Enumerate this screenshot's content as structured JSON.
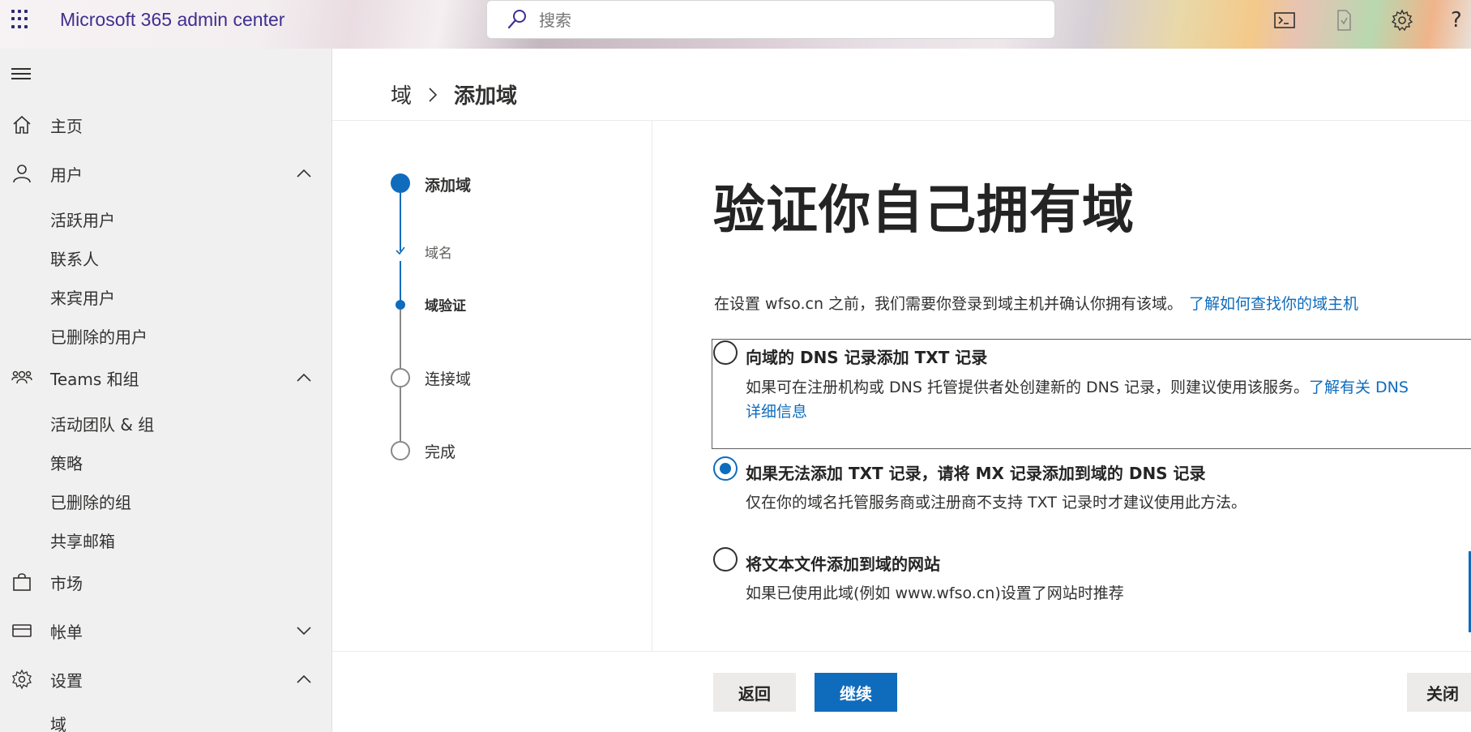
{
  "header": {
    "app_title": "Microsoft 365 admin center",
    "search_placeholder": "搜索",
    "icons": [
      "waffle-icon",
      "search-icon",
      "terminal-icon",
      "document-icon",
      "gear-icon",
      "help-icon"
    ],
    "help_label": "?"
  },
  "sidebar": {
    "items": [
      {
        "label": "主页",
        "icon": "home-icon"
      },
      {
        "label": "用户",
        "icon": "person-icon",
        "expanded": true,
        "children": [
          "活跃用户",
          "联系人",
          "来宾用户",
          "已删除的用户"
        ]
      },
      {
        "label": "Teams 和组",
        "icon": "people-icon",
        "expanded": true,
        "children": [
          "活动团队 & 组",
          "策略",
          "已删除的组",
          "共享邮箱"
        ]
      },
      {
        "label": "市场",
        "icon": "shopping-bag-icon"
      },
      {
        "label": "帐单",
        "icon": "card-icon",
        "expanded": false
      },
      {
        "label": "设置",
        "icon": "gear-icon",
        "expanded": true,
        "children": [
          "域"
        ]
      }
    ]
  },
  "breadcrumb": {
    "root": "域",
    "current": "添加域"
  },
  "steps": [
    {
      "label": "添加域",
      "state": "current"
    },
    {
      "label": "域名",
      "state": "done"
    },
    {
      "label": "域验证",
      "state": "current-sub"
    },
    {
      "label": "连接域",
      "state": "pending"
    },
    {
      "label": "完成",
      "state": "pending"
    }
  ],
  "content": {
    "title": "验证你自己拥有域",
    "intro": "在设置 wfso.cn 之前，我们需要你登录到域主机并确认你拥有该域。",
    "intro_link": "了解如何查找你的域主机",
    "options": [
      {
        "title": "向域的 DNS 记录添加 TXT 记录",
        "desc": "如果可在注册机构或 DNS 托管提供者处创建新的 DNS 记录，则建议使用该服务。",
        "link": "了解有关 DNS",
        "link2": "详细信息",
        "checked": false
      },
      {
        "title": "如果无法添加 TXT 记录，请将 MX 记录添加到域的 DNS 记录",
        "desc": "仅在你的域名托管服务商或注册商不支持 TXT 记录时才建议使用此方法。",
        "checked": true
      },
      {
        "title": "将文本文件添加到域的网站",
        "desc": "如果已使用此域(例如 www.wfso.cn)设置了网站时推荐",
        "checked": false
      }
    ]
  },
  "footer": {
    "back": "返回",
    "next": "继续",
    "close": "关闭"
  },
  "colors": {
    "accent": "#0f6cbd",
    "title": "#3f2f8f",
    "sidebar_bg": "#f0f0f0"
  }
}
